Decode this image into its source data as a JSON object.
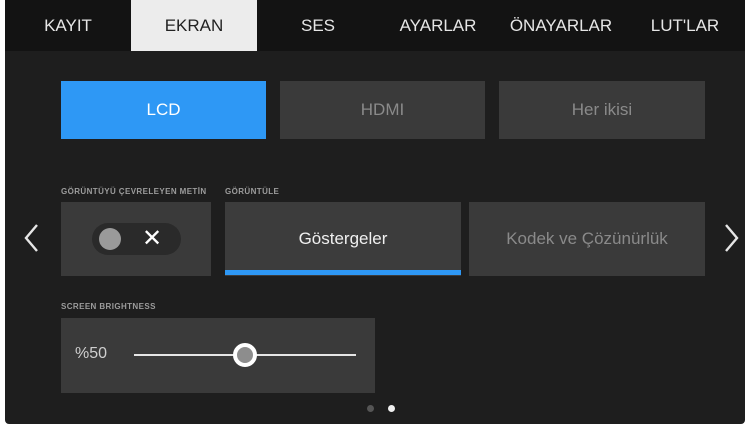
{
  "tabs": [
    {
      "label": "KAYIT",
      "active": false
    },
    {
      "label": "EKRAN",
      "active": true
    },
    {
      "label": "SES",
      "active": false
    },
    {
      "label": "AYARLAR",
      "active": false
    },
    {
      "label": "ÖNAYARLAR",
      "active": false
    },
    {
      "label": "LUT'LAR",
      "active": false
    }
  ],
  "output_select": {
    "options": [
      "LCD",
      "HDMI",
      "Her ikisi"
    ],
    "selected": "LCD"
  },
  "frame_guide_text": {
    "label": "GÖRÜNTÜYÜ ÇEVRELEYEN METİN",
    "toggle_on": false,
    "icon": "close-icon"
  },
  "display": {
    "label": "GÖRÜNTÜLE",
    "options": [
      "Göstergeler",
      "Kodek ve Çözünürlük"
    ],
    "selected": "Göstergeler"
  },
  "brightness": {
    "label": "SCREEN BRIGHTNESS",
    "value_text": "%50",
    "value": 50
  },
  "pagination": {
    "pages": 2,
    "current": 2
  },
  "colors": {
    "accent": "#2e98f5",
    "tile": "#3a3a3a",
    "background": "#1e1e1e"
  },
  "icons": {
    "prev": "chevron-left-icon",
    "next": "chevron-right-icon"
  }
}
